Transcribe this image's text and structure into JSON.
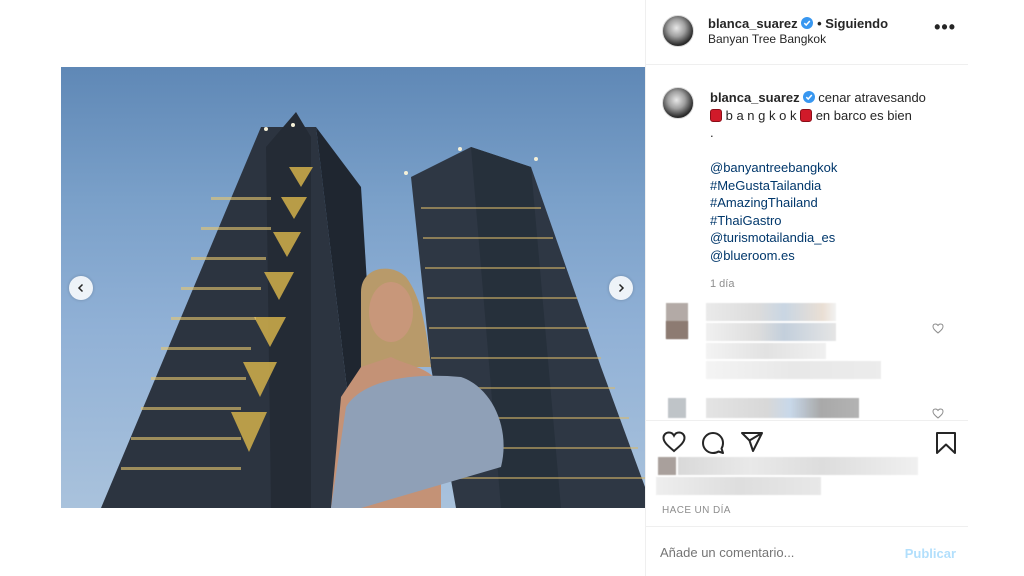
{
  "post": {
    "username": "blanca_suarez",
    "follow_status": "• Siguiendo",
    "location": "Banyan Tree Bangkok",
    "more": "•••"
  },
  "caption": {
    "username": "blanca_suarez",
    "line1": "cenar atravesando",
    "line2_word": "b a n g k o k",
    "line2_rest": "en barco es bien",
    "line3": ".",
    "tags": [
      "@banyantreebangkok",
      "#MeGustaTailandia",
      "#AmazingThailand",
      "#ThaiGastro",
      "@turismotailandia_es",
      "@blueroom.es"
    ],
    "time": "1 día"
  },
  "actions": {
    "date": "HACE UN DÍA"
  },
  "comment": {
    "placeholder": "Añade un comentario...",
    "publish": "Publicar"
  },
  "colors": {
    "link": "#00376b",
    "verified": "#3897f0",
    "publish_disabled": "#b2dffc"
  }
}
